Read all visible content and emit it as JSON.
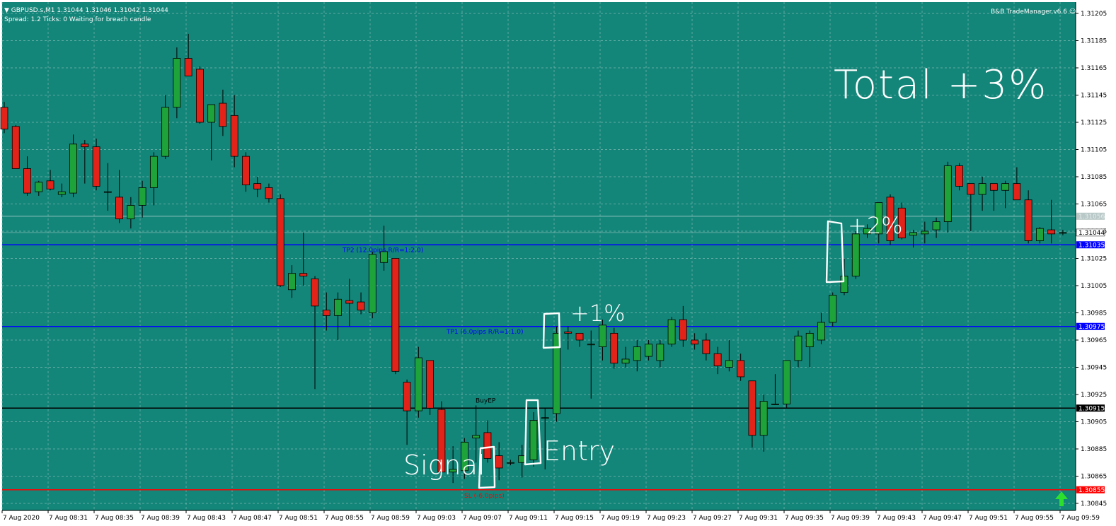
{
  "header": {
    "symbol_line": "▼ GBPUSD.s,M1  1.31044 1.31046 1.31042 1.31044",
    "status_line": "Spread: 1.2   Ticks: 0   Waiting for breach candle",
    "expert_label": "B&B TradeManager.v6.6",
    "expert_icon": "smiley-icon"
  },
  "annotations": {
    "total": "Total +3%",
    "plus2": "+2%",
    "plus1": "+1%",
    "entry": "Entry",
    "signal": "Signal"
  },
  "colors": {
    "background": "#138579",
    "grid": "#7fb8b1",
    "bull": "#1ea33a",
    "bear": "#e2231a",
    "tp_line": "#0000ff",
    "entry_line": "#000000",
    "sl_line": "#ff0000",
    "arrow": "#2ee02e"
  },
  "chart_data": {
    "type": "candlestick",
    "symbol": "GBPUSD.s",
    "timeframe": "M1",
    "ylim": [
      1.30845,
      1.31205
    ],
    "y_ticks": [
      "1.31205",
      "1.31185",
      "1.31165",
      "1.31145",
      "1.31125",
      "1.31105",
      "1.31085",
      "1.31065",
      "1.31045",
      "1.31025",
      "1.31005",
      "1.30985",
      "1.30965",
      "1.30945",
      "1.30925",
      "1.30905",
      "1.30885",
      "1.30865",
      "1.30845"
    ],
    "x_ticks": [
      "7 Aug 2020",
      "7 Aug 08:31",
      "7 Aug 08:35",
      "7 Aug 08:39",
      "7 Aug 08:43",
      "7 Aug 08:47",
      "7 Aug 08:51",
      "7 Aug 08:55",
      "7 Aug 08:59",
      "7 Aug 09:03",
      "7 Aug 09:07",
      "7 Aug 09:11",
      "7 Aug 09:15",
      "7 Aug 09:19",
      "7 Aug 09:23",
      "7 Aug 09:27",
      "7 Aug 09:31",
      "7 Aug 09:35",
      "7 Aug 09:39",
      "7 Aug 09:43",
      "7 Aug 09:47",
      "7 Aug 09:51",
      "7 Aug 09:55",
      "7 Aug 09:59"
    ],
    "candles": [
      {
        "o": 1.31136,
        "h": 1.3114,
        "l": 1.31117,
        "c": 1.3112
      },
      {
        "o": 1.31122,
        "h": 1.31123,
        "l": 1.31091,
        "c": 1.31091
      },
      {
        "o": 1.31091,
        "h": 1.311,
        "l": 1.31071,
        "c": 1.31073
      },
      {
        "o": 1.31074,
        "h": 1.31082,
        "l": 1.31071,
        "c": 1.31081
      },
      {
        "o": 1.31082,
        "h": 1.3109,
        "l": 1.31075,
        "c": 1.31076
      },
      {
        "o": 1.31072,
        "h": 1.3108,
        "l": 1.3107,
        "c": 1.31074
      },
      {
        "o": 1.31073,
        "h": 1.31116,
        "l": 1.3107,
        "c": 1.31109
      },
      {
        "o": 1.31109,
        "h": 1.31112,
        "l": 1.3108,
        "c": 1.31107
      },
      {
        "o": 1.31107,
        "h": 1.31113,
        "l": 1.31075,
        "c": 1.31078
      },
      {
        "o": 1.31074,
        "h": 1.31095,
        "l": 1.3106,
        "c": 1.31074
      },
      {
        "o": 1.3107,
        "h": 1.3109,
        "l": 1.31051,
        "c": 1.31054
      },
      {
        "o": 1.31054,
        "h": 1.3107,
        "l": 1.31047,
        "c": 1.31064
      },
      {
        "o": 1.31064,
        "h": 1.31082,
        "l": 1.31055,
        "c": 1.31077
      },
      {
        "o": 1.31077,
        "h": 1.31103,
        "l": 1.31064,
        "c": 1.311
      },
      {
        "o": 1.311,
        "h": 1.31145,
        "l": 1.31098,
        "c": 1.31136
      },
      {
        "o": 1.31136,
        "h": 1.3118,
        "l": 1.31128,
        "c": 1.31172
      },
      {
        "o": 1.31172,
        "h": 1.3119,
        "l": 1.31159,
        "c": 1.31159
      },
      {
        "o": 1.31164,
        "h": 1.31166,
        "l": 1.31124,
        "c": 1.31125
      },
      {
        "o": 1.31125,
        "h": 1.31135,
        "l": 1.31097,
        "c": 1.31138
      },
      {
        "o": 1.31139,
        "h": 1.31149,
        "l": 1.31115,
        "c": 1.31122
      },
      {
        "o": 1.3113,
        "h": 1.31145,
        "l": 1.31092,
        "c": 1.311
      },
      {
        "o": 1.311,
        "h": 1.31103,
        "l": 1.31074,
        "c": 1.31079
      },
      {
        "o": 1.3108,
        "h": 1.31085,
        "l": 1.3107,
        "c": 1.31076
      },
      {
        "o": 1.31077,
        "h": 1.3108,
        "l": 1.31066,
        "c": 1.31069
      },
      {
        "o": 1.31069,
        "h": 1.31072,
        "l": 1.31004,
        "c": 1.31005
      },
      {
        "o": 1.31002,
        "h": 1.3102,
        "l": 1.30996,
        "c": 1.31014
      },
      {
        "o": 1.31014,
        "h": 1.31044,
        "l": 1.31005,
        "c": 1.31012
      },
      {
        "o": 1.3101,
        "h": 1.31012,
        "l": 1.30929,
        "c": 1.3099
      },
      {
        "o": 1.30987,
        "h": 1.31,
        "l": 1.30972,
        "c": 1.30983
      },
      {
        "o": 1.30983,
        "h": 1.31,
        "l": 1.30965,
        "c": 1.30995
      },
      {
        "o": 1.30994,
        "h": 1.3101,
        "l": 1.30975,
        "c": 1.30992
      },
      {
        "o": 1.30993,
        "h": 1.31,
        "l": 1.30984,
        "c": 1.30987
      },
      {
        "o": 1.30985,
        "h": 1.3103,
        "l": 1.30981,
        "c": 1.31028
      },
      {
        "o": 1.31022,
        "h": 1.31049,
        "l": 1.31016,
        "c": 1.3103
      },
      {
        "o": 1.31025,
        "h": 1.31025,
        "l": 1.3094,
        "c": 1.30942
      },
      {
        "o": 1.30934,
        "h": 1.30936,
        "l": 1.30888,
        "c": 1.30913
      },
      {
        "o": 1.30913,
        "h": 1.3096,
        "l": 1.30908,
        "c": 1.30952
      },
      {
        "o": 1.3095,
        "h": 1.3095,
        "l": 1.3091,
        "c": 1.30915
      },
      {
        "o": 1.30914,
        "h": 1.3092,
        "l": 1.30865,
        "c": 1.30868
      },
      {
        "o": 1.30868,
        "h": 1.30887,
        "l": 1.3086,
        "c": 1.3087
      },
      {
        "o": 1.30869,
        "h": 1.30893,
        "l": 1.30863,
        "c": 1.3089
      },
      {
        "o": 1.30893,
        "h": 1.30917,
        "l": 1.30875,
        "c": 1.30895
      },
      {
        "o": 1.30897,
        "h": 1.30906,
        "l": 1.30875,
        "c": 1.30878
      },
      {
        "o": 1.3088,
        "h": 1.3089,
        "l": 1.30862,
        "c": 1.30871
      },
      {
        "o": 1.30875,
        "h": 1.30877,
        "l": 1.30873,
        "c": 1.30875
      },
      {
        "o": 1.30875,
        "h": 1.30888,
        "l": 1.30864,
        "c": 1.3088
      },
      {
        "o": 1.30877,
        "h": 1.30912,
        "l": 1.30872,
        "c": 1.30906
      },
      {
        "o": 1.30908,
        "h": 1.30915,
        "l": 1.3087,
        "c": 1.30908
      },
      {
        "o": 1.30911,
        "h": 1.30975,
        "l": 1.30905,
        "c": 1.3097
      },
      {
        "o": 1.30971,
        "h": 1.30975,
        "l": 1.30958,
        "c": 1.3097
      },
      {
        "o": 1.3097,
        "h": 1.3097,
        "l": 1.3096,
        "c": 1.30965
      },
      {
        "o": 1.30962,
        "h": 1.30972,
        "l": 1.30922,
        "c": 1.30962
      },
      {
        "o": 1.3096,
        "h": 1.3098,
        "l": 1.3095,
        "c": 1.30976
      },
      {
        "o": 1.3097,
        "h": 1.30974,
        "l": 1.30944,
        "c": 1.30948
      },
      {
        "o": 1.30948,
        "h": 1.3096,
        "l": 1.30945,
        "c": 1.30951
      },
      {
        "o": 1.3095,
        "h": 1.30965,
        "l": 1.30942,
        "c": 1.3096
      },
      {
        "o": 1.30953,
        "h": 1.30965,
        "l": 1.3095,
        "c": 1.30962
      },
      {
        "o": 1.3095,
        "h": 1.30965,
        "l": 1.30945,
        "c": 1.30962
      },
      {
        "o": 1.30962,
        "h": 1.30982,
        "l": 1.3096,
        "c": 1.3098
      },
      {
        "o": 1.3098,
        "h": 1.3099,
        "l": 1.3096,
        "c": 1.30965
      },
      {
        "o": 1.30965,
        "h": 1.3097,
        "l": 1.30958,
        "c": 1.30962
      },
      {
        "o": 1.30965,
        "h": 1.3097,
        "l": 1.3095,
        "c": 1.30955
      },
      {
        "o": 1.30955,
        "h": 1.3096,
        "l": 1.3094,
        "c": 1.30946
      },
      {
        "o": 1.30945,
        "h": 1.30965,
        "l": 1.30942,
        "c": 1.3095
      },
      {
        "o": 1.3095,
        "h": 1.30955,
        "l": 1.30935,
        "c": 1.30938
      },
      {
        "o": 1.30935,
        "h": 1.30935,
        "l": 1.30886,
        "c": 1.30895
      },
      {
        "o": 1.30895,
        "h": 1.30925,
        "l": 1.30883,
        "c": 1.3092
      },
      {
        "o": 1.30918,
        "h": 1.3094,
        "l": 1.30918,
        "c": 1.30918
      },
      {
        "o": 1.30918,
        "h": 1.3095,
        "l": 1.30915,
        "c": 1.3095
      },
      {
        "o": 1.3095,
        "h": 1.30972,
        "l": 1.30945,
        "c": 1.30968
      },
      {
        "o": 1.3096,
        "h": 1.30972,
        "l": 1.30945,
        "c": 1.3097
      },
      {
        "o": 1.30965,
        "h": 1.30985,
        "l": 1.30962,
        "c": 1.30978
      },
      {
        "o": 1.30978,
        "h": 1.31,
        "l": 1.30975,
        "c": 1.30998
      },
      {
        "o": 1.31,
        "h": 1.31025,
        "l": 1.30998,
        "c": 1.31012
      },
      {
        "o": 1.31012,
        "h": 1.31045,
        "l": 1.3101,
        "c": 1.31043
      },
      {
        "o": 1.31043,
        "h": 1.3105,
        "l": 1.3104,
        "c": 1.31047
      },
      {
        "o": 1.31043,
        "h": 1.31066,
        "l": 1.31036,
        "c": 1.31066
      },
      {
        "o": 1.3107,
        "h": 1.31072,
        "l": 1.31035,
        "c": 1.31038
      },
      {
        "o": 1.31062,
        "h": 1.31066,
        "l": 1.31039,
        "c": 1.3104
      },
      {
        "o": 1.31042,
        "h": 1.31046,
        "l": 1.31033,
        "c": 1.31044
      },
      {
        "o": 1.31043,
        "h": 1.31052,
        "l": 1.31036,
        "c": 1.31045
      },
      {
        "o": 1.31046,
        "h": 1.31055,
        "l": 1.3104,
        "c": 1.31052
      },
      {
        "o": 1.31052,
        "h": 1.31096,
        "l": 1.31044,
        "c": 1.31093
      },
      {
        "o": 1.31093,
        "h": 1.31095,
        "l": 1.31075,
        "c": 1.31078
      },
      {
        "o": 1.3108,
        "h": 1.3108,
        "l": 1.31045,
        "c": 1.31072
      },
      {
        "o": 1.31072,
        "h": 1.31085,
        "l": 1.3106,
        "c": 1.3108
      },
      {
        "o": 1.3108,
        "h": 1.3108,
        "l": 1.3106,
        "c": 1.31075
      },
      {
        "o": 1.31075,
        "h": 1.31082,
        "l": 1.31062,
        "c": 1.3108
      },
      {
        "o": 1.3108,
        "h": 1.31092,
        "l": 1.3107,
        "c": 1.31068
      },
      {
        "o": 1.31068,
        "h": 1.31075,
        "l": 1.31036,
        "c": 1.31038
      },
      {
        "o": 1.31038,
        "h": 1.31048,
        "l": 1.31036,
        "c": 1.31047
      },
      {
        "o": 1.31046,
        "h": 1.31068,
        "l": 1.31036,
        "c": 1.31043
      },
      {
        "o": 1.31044,
        "h": 1.31046,
        "l": 1.31042,
        "c": 1.31044
      }
    ],
    "price_lines": [
      {
        "name": "TP2",
        "label": "TP2 (12.0pips R/R=1:2.0)",
        "price": 1.31035,
        "tag": "1.31035",
        "color": "#0000ff"
      },
      {
        "name": "TP1",
        "label": "TP1 (6.0pips R/R=1:1.0)",
        "price": 1.30975,
        "tag": "1.30975",
        "color": "#0000ff"
      },
      {
        "name": "Entry",
        "label": "",
        "price": 1.30915,
        "tag": "1.30915",
        "color": "#000000"
      },
      {
        "name": "SL",
        "label": "SL (-6.0pips)",
        "price": 1.30855,
        "tag": "1.30855",
        "color": "#ff0000"
      }
    ],
    "bid_line": {
      "price": 1.31044,
      "tag": "1.31044"
    },
    "ask_line": {
      "price": 1.31056,
      "tag": "1.31056"
    },
    "marker_label": "BuyEP",
    "grid": true
  }
}
